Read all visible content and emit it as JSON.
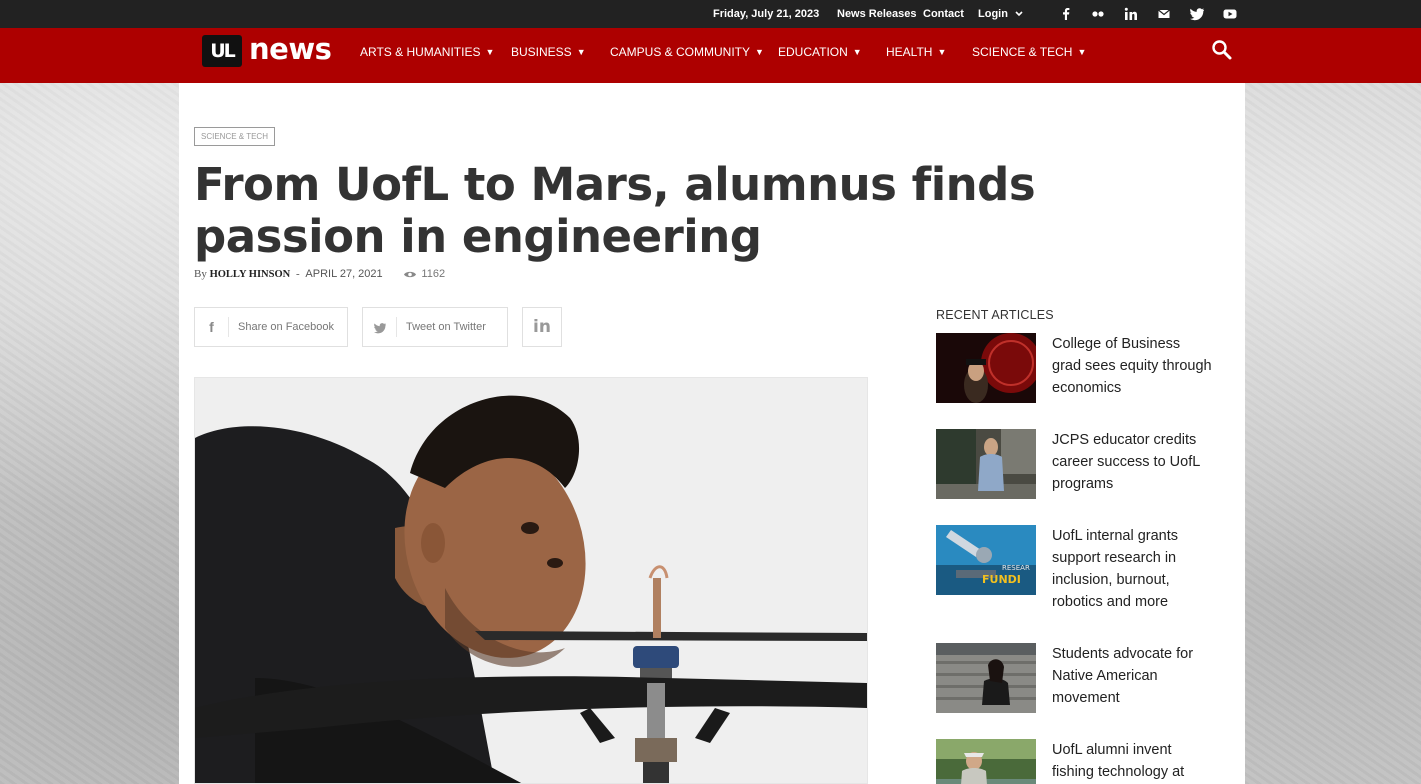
{
  "topbar": {
    "date": "Friday, July 21, 2023",
    "links": [
      "News Releases",
      "Contact",
      "Login"
    ],
    "login_chevron": "⌄",
    "social_icons": [
      "facebook-icon",
      "flickr-icon",
      "linkedin-icon",
      "email-icon",
      "twitter-icon",
      "youtube-icon"
    ]
  },
  "nav": {
    "logo_ul": "UL",
    "logo_news": "news",
    "items": [
      "ARTS & HUMANITIES",
      "BUSINESS",
      "CAMPUS & COMMUNITY",
      "EDUCATION",
      "HEALTH",
      "SCIENCE & TECH"
    ],
    "accent_color": "#ad0000"
  },
  "article": {
    "category": "SCIENCE & TECH",
    "title": "From UofL to Mars, alumnus finds passion in engineering",
    "by_label": "By",
    "author": "HOLLY HINSON",
    "separator": "-",
    "date": "APRIL 27, 2021",
    "views": "1162",
    "share": {
      "facebook": "Share on Facebook",
      "twitter": "Tweet on Twitter"
    }
  },
  "sidebar": {
    "heading": "RECENT ARTICLES",
    "items": [
      {
        "title": "College of Business grad sees equity through economics"
      },
      {
        "title": "JCPS educator credits career success to UofL programs"
      },
      {
        "title": "UofL internal grants support research in inclusion, burnout, robotics and more"
      },
      {
        "title": "Students advocate for Native American movement"
      },
      {
        "title": "UofL alumni invent fishing technology at"
      }
    ]
  }
}
